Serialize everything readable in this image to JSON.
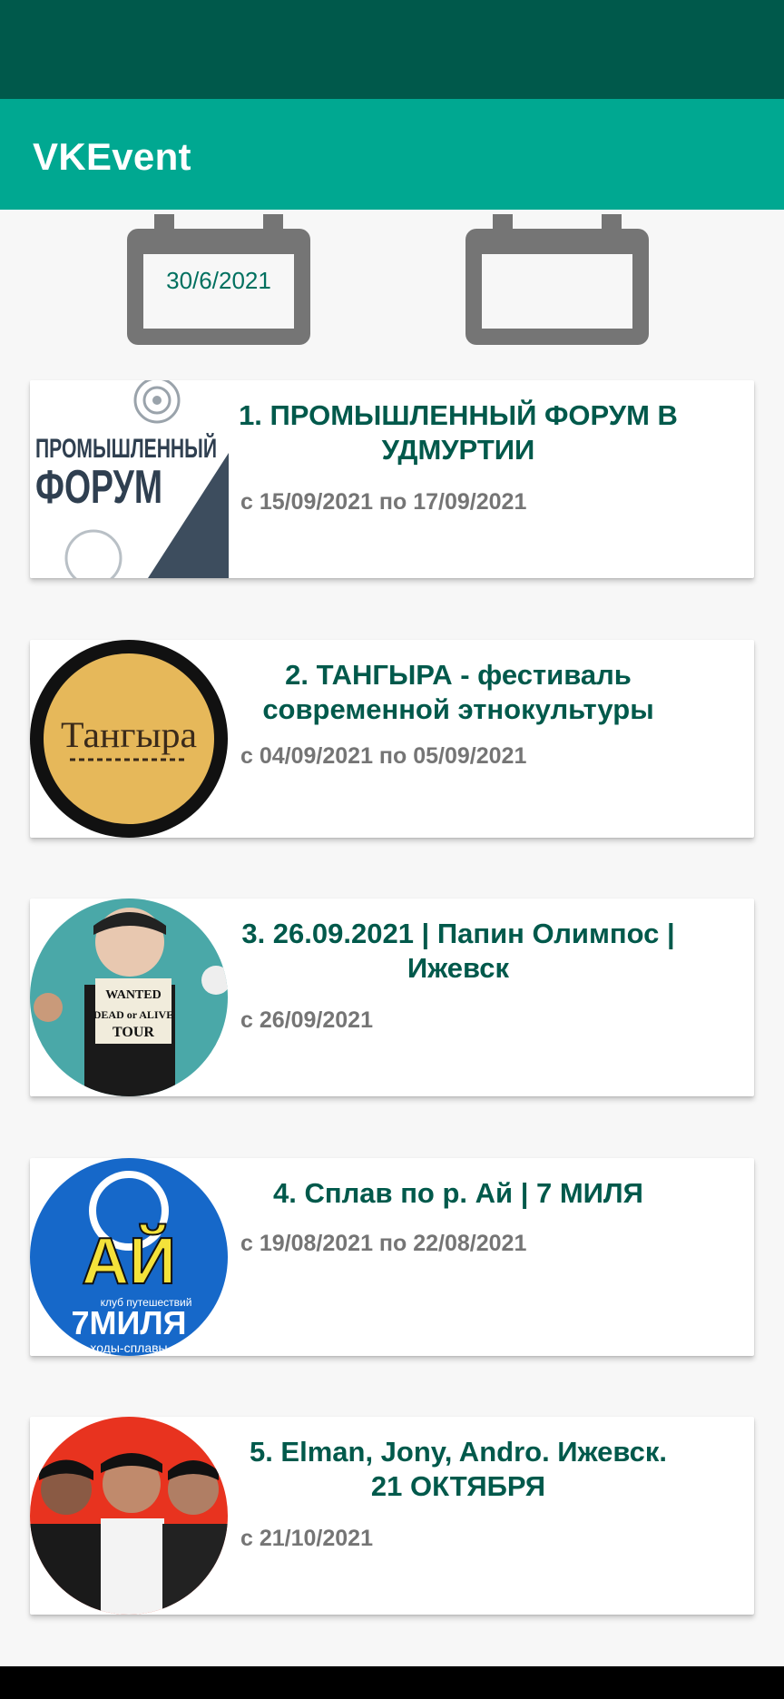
{
  "app": {
    "title": "VKEvent"
  },
  "filters": {
    "date_from": "30/6/2021",
    "date_to": ""
  },
  "events": [
    {
      "title": "1.  ПРОМЫШЛЕННЫЙ ФОРУМ В УДМУРТИИ",
      "dates": "с 15/09/2021 по 17/09/2021",
      "image_text": [
        "ПРОМЫШЛЕННЫЙ",
        "ФОРУМ"
      ]
    },
    {
      "title": "2.  ТАНГЫРА - фестиваль современной этнокультуры",
      "dates": "с 04/09/2021 по 05/09/2021",
      "image_text": [
        "Тангыра"
      ]
    },
    {
      "title": "3.  26.09.2021 | Папин Олимпос | Ижевск",
      "dates": "с 26/09/2021",
      "image_text": [
        "WANTED",
        "DEAD or ALIVE",
        "TOUR"
      ]
    },
    {
      "title": "4.  Сплав по р. Ай  | 7 МИЛЯ",
      "dates": "с 19/08/2021 по 22/08/2021",
      "image_text": [
        "АЙ",
        "клуб путешествий",
        "7МИЛЯ",
        "ходы-сплавы"
      ]
    },
    {
      "title": "5.  Elman, Jony, Andro. Ижевск. 21 ОКТЯБРЯ",
      "dates": "с 21/10/2021",
      "image_text": []
    }
  ],
  "colors": {
    "status_bar": "#00594b",
    "app_bar": "#00a891",
    "title_text": "#00594b",
    "date_text": "#757575",
    "calendar_icon": "#757575"
  }
}
